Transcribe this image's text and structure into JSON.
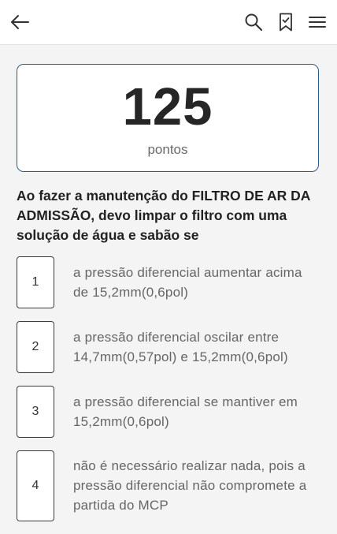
{
  "header": {
    "back_icon": "arrow-left-icon",
    "search_icon": "search-icon",
    "bookmark_icon": "bookmark-check-icon",
    "menu_icon": "hamburger-menu-icon"
  },
  "score": {
    "value": "125",
    "label": "pontos"
  },
  "question": {
    "text": "Ao fazer a manutenção do FILTRO DE AR DA ADMISSÃO, devo limpar o filtro com uma solução de água e sabão se"
  },
  "options": [
    {
      "number": "1",
      "text": "a pressão diferencial aumentar acima de 15,2mm(0,6pol)"
    },
    {
      "number": "2",
      "text": "a pressão diferencial oscilar entre 14,7mm(0,57pol) e 15,2mm(0,6pol)"
    },
    {
      "number": "3",
      "text": "a pressão diferencial se mantiver em 15,2mm(0,6pol)"
    },
    {
      "number": "4",
      "text": "não é necessário realizar nada, pois a pressão diferencial não compromete a partida do MCP"
    }
  ],
  "colors": {
    "card_border": "#2d5b8c",
    "background": "#f4f4f4",
    "text_dark": "#222222",
    "text_muted": "#666666"
  }
}
